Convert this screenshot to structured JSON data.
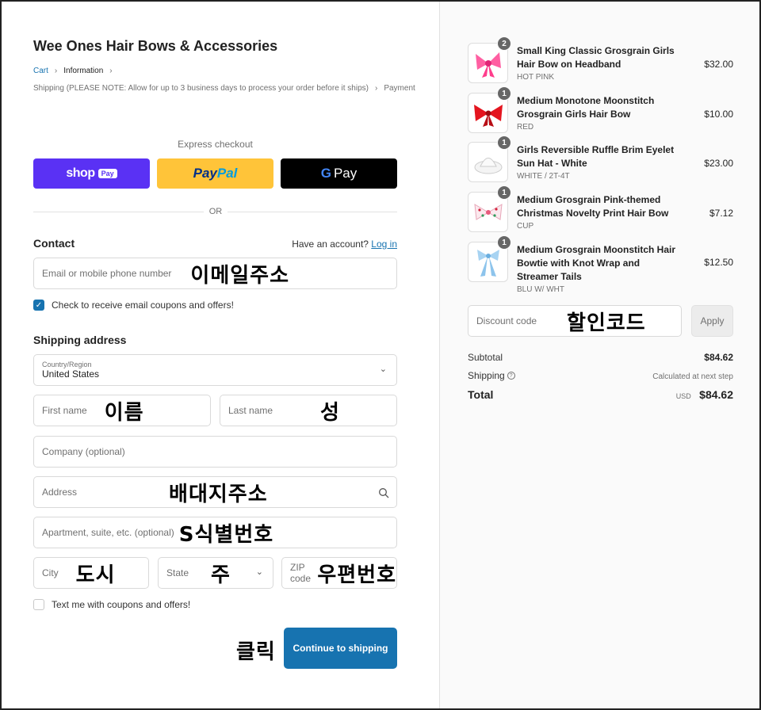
{
  "store": {
    "name": "Wee Ones Hair Bows & Accessories"
  },
  "breadcrumb": {
    "cart": "Cart",
    "information": "Information",
    "shipping": "Shipping (PLEASE NOTE: Allow for up to 3 business days to process your order before it ships)",
    "payment": "Payment",
    "separator": "›"
  },
  "express": {
    "label": "Express checkout",
    "shop_logo": "shop",
    "shop_chip": "Pay",
    "paypal_a": "Pay",
    "paypal_b": "Pal",
    "gpay_g": "G",
    "gpay_label": "Pay",
    "or": "OR"
  },
  "contact": {
    "heading": "Contact",
    "account_prompt": "Have an account?",
    "login": "Log in",
    "email_placeholder": "Email or mobile phone number",
    "email_annotation": "이메일주소",
    "coupon_checkbox": "Check to receive email coupons and offers!",
    "coupon_checked": true
  },
  "shipping": {
    "heading": "Shipping address",
    "country_label": "Country/Region",
    "country_value": "United States",
    "first_name": "First name",
    "first_name_annotation": "이름",
    "last_name": "Last name",
    "last_name_annotation": "성",
    "company": "Company (optional)",
    "address": "Address",
    "address_annotation": "배대지주소",
    "apartment": "Apartment, suite, etc. (optional)",
    "apartment_annotation": "S식별번호",
    "city": "City",
    "city_annotation": "도시",
    "state": "State",
    "state_annotation": "주",
    "zip": "ZIP code",
    "zip_annotation": "우편번호",
    "text_checkbox": "Text me with coupons and offers!",
    "text_checked": false
  },
  "actions": {
    "click_annotation": "클릭",
    "continue": "Continue to shipping"
  },
  "order": {
    "items": [
      {
        "qty": "2",
        "name": "Small King Classic Grosgrain Girls Hair Bow on Headband",
        "variant": "HOT PINK",
        "price": "$32.00",
        "thumb": "pink-bow-icon"
      },
      {
        "qty": "1",
        "name": "Medium Monotone Moonstitch Grosgrain Girls Hair Bow",
        "variant": "RED",
        "price": "$10.00",
        "thumb": "red-bow-icon"
      },
      {
        "qty": "1",
        "name": "Girls Reversible Ruffle Brim Eyelet Sun Hat - White",
        "variant": "WHITE / 2T-4T",
        "price": "$23.00",
        "thumb": "white-hat-icon"
      },
      {
        "qty": "1",
        "name": "Medium Grosgrain Pink-themed Christmas Novelty Print Hair Bow",
        "variant": "CUP",
        "price": "$7.12",
        "thumb": "print-bow-icon"
      },
      {
        "qty": "1",
        "name": "Medium Grosgrain Moonstitch Hair Bowtie with Knot Wrap and Streamer Tails",
        "variant": "BLU W/ WHT",
        "price": "$12.50",
        "thumb": "blue-bow-icon"
      }
    ],
    "discount_placeholder": "Discount code",
    "discount_annotation": "할인코드",
    "apply": "Apply",
    "subtotal_label": "Subtotal",
    "subtotal_value": "$84.62",
    "shipping_label": "Shipping",
    "shipping_value": "Calculated at next step",
    "total_label": "Total",
    "currency": "USD",
    "total_value": "$84.62"
  },
  "colors": {
    "accent": "#1773b0",
    "shop_pay": "#5a31f4",
    "paypal": "#ffc439"
  }
}
